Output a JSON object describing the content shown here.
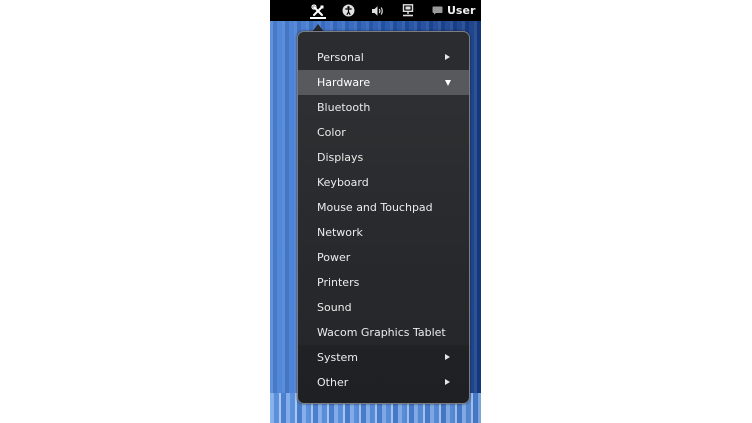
{
  "topbar": {
    "icons": [
      "settings-icon",
      "accessibility-icon",
      "volume-icon",
      "network-icon",
      "chat-icon"
    ],
    "user_label": "User"
  },
  "menu": {
    "sections": [
      {
        "label": "Personal",
        "arrow": "right"
      },
      {
        "label": "Hardware",
        "arrow": "down",
        "expanded": true
      },
      {
        "label": "System",
        "arrow": "right"
      },
      {
        "label": "Other",
        "arrow": "right"
      }
    ],
    "hardware_items": [
      "Bluetooth",
      "Color",
      "Displays",
      "Keyboard",
      "Mouse and Touchpad",
      "Network",
      "Power",
      "Printers",
      "Sound",
      "Wacom Graphics Tablet"
    ]
  },
  "colors": {
    "menu_background": "#222427",
    "highlight": "#58595c",
    "topbar": "#000000",
    "desktop_blue": "#2456ad"
  }
}
